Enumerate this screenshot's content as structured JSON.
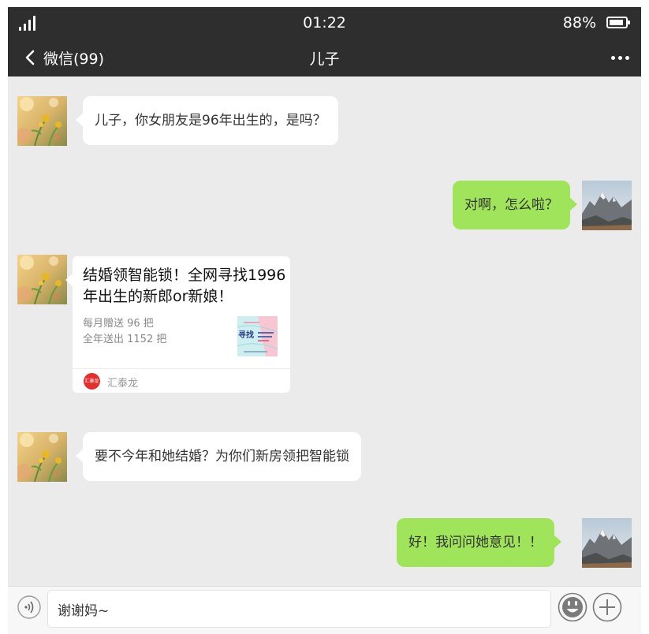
{
  "status_bar": {
    "time": "01:22",
    "battery": "88%",
    "battery_level": 0.88,
    "icons": [
      "signal-icon",
      "battery-icon"
    ]
  },
  "nav": {
    "back_label": "微信(99)",
    "title": "儿子",
    "icons": [
      "back-icon",
      "more-icon"
    ]
  },
  "messages": [
    {
      "side": "left",
      "text": "儿子，你女朋友是96年出生的，是吗？"
    },
    {
      "side": "right",
      "text": "对啊，怎么啦？"
    },
    {
      "side": "left",
      "type": "card",
      "title": "结婚领智能锁！全网寻找1996年出生的新郎or新娘！",
      "desc_line1": "每月赠送 96 把",
      "desc_line2": "全年送出 1152 把",
      "thumb_text": "寻找",
      "source_logo": "汇泰龙",
      "source": "汇泰龙"
    },
    {
      "side": "left",
      "text": "要不今年和她结婚？为你们新房领把智能锁"
    },
    {
      "side": "right",
      "text": "好！我问问她意见！！"
    }
  ],
  "input": {
    "value": "谢谢妈~",
    "icons": [
      "voice-icon",
      "emoji-icon",
      "plus-icon"
    ]
  },
  "colors": {
    "header_bg": "#2e2e2e",
    "chat_bg": "#ebebeb",
    "sent_bubble": "#9fe45a",
    "received_bubble": "#ffffff"
  }
}
